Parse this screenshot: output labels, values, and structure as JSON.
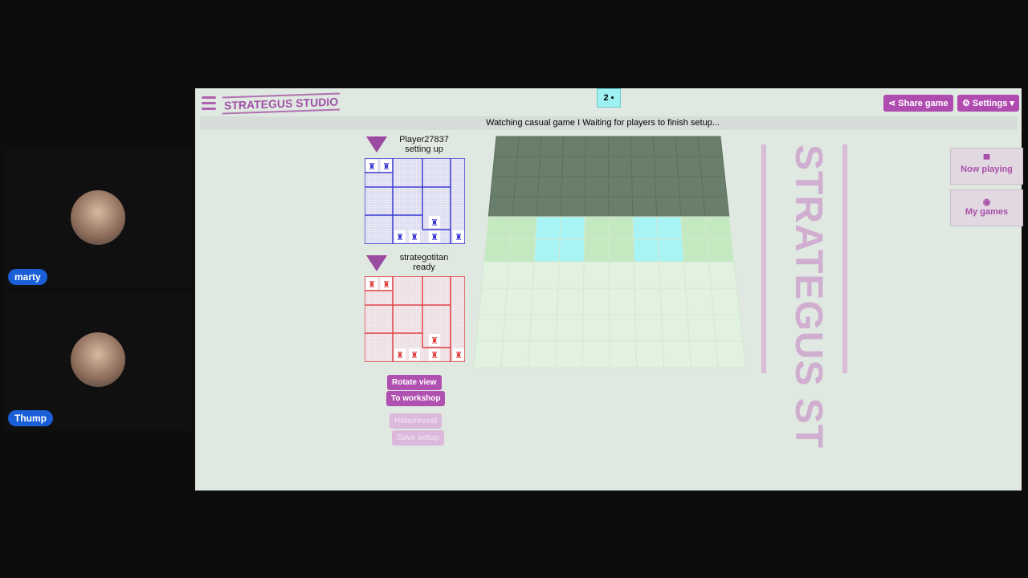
{
  "participants": [
    {
      "name": "marty"
    },
    {
      "name": "Thump"
    }
  ],
  "app": {
    "logo": "STRATEGUS STUDIO",
    "spectator_count": "2",
    "share_label": "Share game",
    "settings_label": "Settings",
    "status": "Watching casual game I Waiting for players to finish setup...",
    "side_nav": [
      {
        "label": "Now playing",
        "icon": "gamepad-icon"
      },
      {
        "label": "My games",
        "icon": "play-circle-icon"
      }
    ],
    "players": [
      {
        "name": "Player27837",
        "state": "setting up",
        "color": "#3a3ad0"
      },
      {
        "name": "strategotitan",
        "state": "ready",
        "color": "#e04040"
      }
    ],
    "buttons": {
      "rotate": "Rotate view",
      "workshop": "To workshop",
      "hide": "Hide/reveal",
      "save": "Save setup"
    },
    "banner": "STRATEGUS ST",
    "board": {
      "rows": 10,
      "cols": 10,
      "lakes": [
        [
          4,
          2
        ],
        [
          4,
          3
        ],
        [
          5,
          2
        ],
        [
          5,
          3
        ],
        [
          4,
          6
        ],
        [
          4,
          7
        ],
        [
          5,
          6
        ],
        [
          5,
          7
        ]
      ]
    }
  }
}
